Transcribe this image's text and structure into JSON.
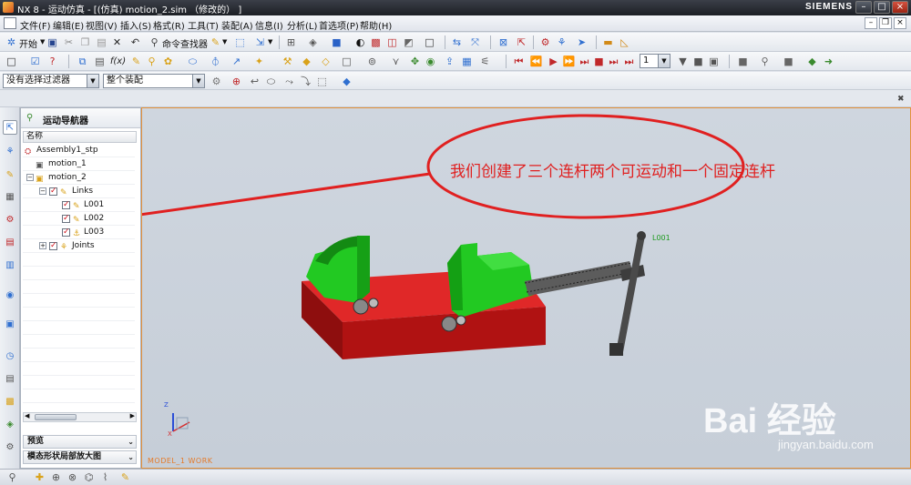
{
  "window": {
    "title": "NX 8 - 运动仿真 - [(仿真) motion_2.sim （修改的） ]",
    "brand": "SIEMENS",
    "minimize": "–",
    "maximize": "□",
    "close": "×"
  },
  "menubar": {
    "items": [
      "文件(F)",
      "编辑(E)",
      "视图(V)",
      "插入(S)",
      "格式(R)",
      "工具(T)",
      "装配(A)",
      "信息(I)",
      "分析(L)",
      "首选项(P)",
      "帮助(H)"
    ]
  },
  "toolbar1": {
    "start_label": "开始",
    "command_finder_label": "命令查找器"
  },
  "toolbar2": {
    "step_value": "1"
  },
  "selection_bar": {
    "filter": "没有选择过滤器",
    "scope": "整个装配"
  },
  "navigator": {
    "title": "运动导航器",
    "column_header": "名称",
    "tree": [
      {
        "label": "Assembly1_stp",
        "icon": "assembly-icon"
      },
      {
        "label": "motion_1",
        "icon": "motion-icon"
      },
      {
        "label": "motion_2",
        "icon": "motion-icon"
      },
      {
        "label": "Links",
        "icon": "links-folder-icon"
      },
      {
        "label": "L001",
        "icon": "link-icon"
      },
      {
        "label": "L002",
        "icon": "link-icon"
      },
      {
        "label": "L003",
        "icon": "fixed-link-icon"
      },
      {
        "label": "Joints",
        "icon": "joints-folder-icon"
      }
    ],
    "section_preview": "预览",
    "section_shape": "模态形状局部放大图"
  },
  "viewport": {
    "callout": "我们创建了三个连杆两个可运动和一个固定连杆",
    "link_tag": "L001",
    "work_label": "MODEL_1 WORK",
    "axis_x": "X",
    "axis_z": "Z"
  },
  "watermark": {
    "logo": "Bai 经验",
    "url": "jingyan.baidu.com"
  },
  "colors": {
    "callout": "#e02020",
    "model_red": "#b81414",
    "model_green": "#19c419",
    "viewport_border": "#e3913b"
  }
}
